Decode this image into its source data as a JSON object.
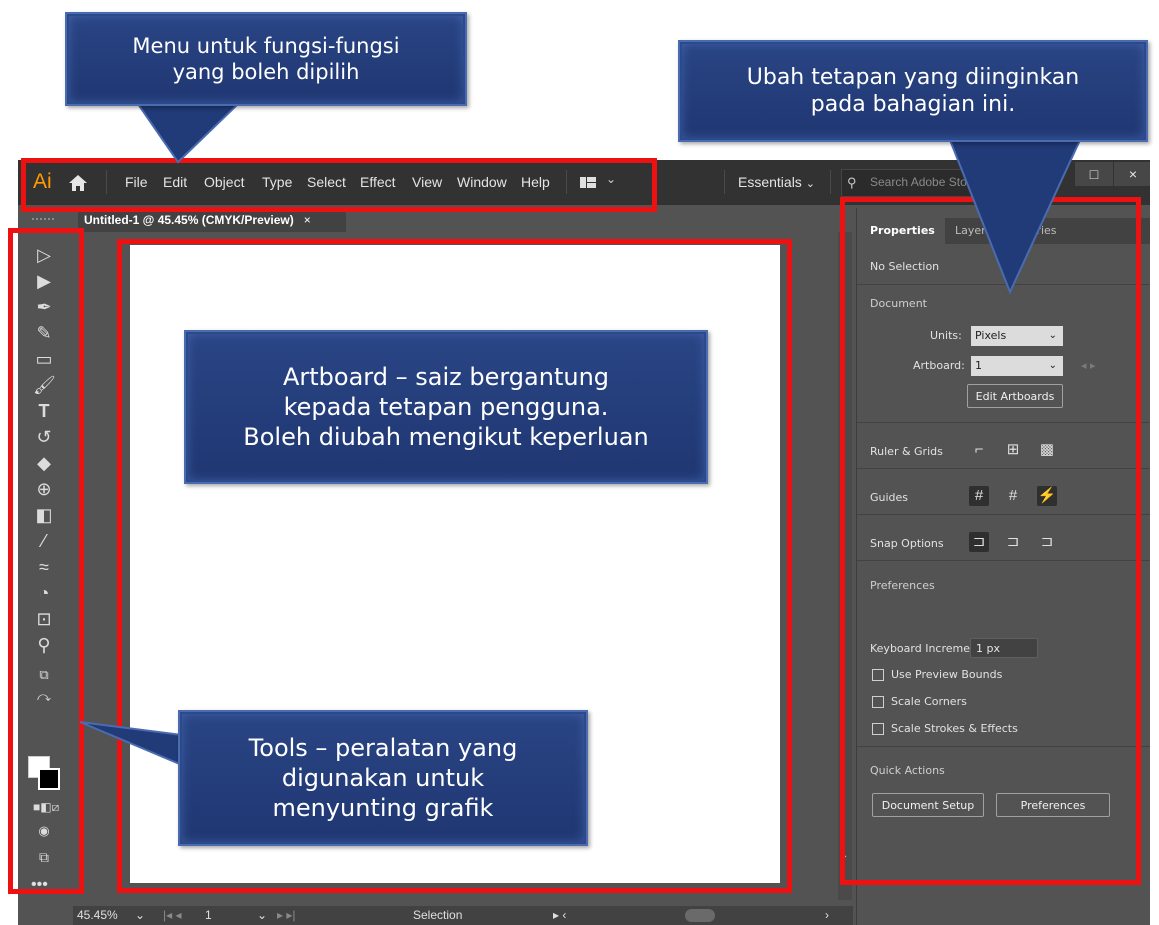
{
  "app": {
    "logo": "Ai",
    "menu": [
      "File",
      "Edit",
      "Object",
      "Type",
      "Select",
      "Effect",
      "View",
      "Window",
      "Help"
    ],
    "workspace": "Essentials",
    "search_placeholder": "Search Adobe Stoc",
    "win_restore": "□",
    "win_close": "×"
  },
  "document": {
    "tab_title": "Untitled-1 @ 45.45% (CMYK/Preview)",
    "tab_close": "×"
  },
  "status": {
    "zoom": "45.45%",
    "artboard_num": "1",
    "tool_name": "Selection"
  },
  "panel": {
    "tabs": [
      "Properties",
      "Layers",
      "Libraries"
    ],
    "selection": "No Selection",
    "document_heading": "Document",
    "units_label": "Units:",
    "units_value": "Pixels",
    "artboard_label": "Artboard:",
    "artboard_value": "1",
    "edit_artboards": "Edit Artboards",
    "ruler_grids": "Ruler & Grids",
    "guides": "Guides",
    "snap_options": "Snap Options",
    "preferences_heading": "Preferences",
    "keyboard_increment_label": "Keyboard Increment:",
    "keyboard_increment_value": "1 px",
    "use_preview_bounds": "Use Preview Bounds",
    "scale_corners": "Scale Corners",
    "scale_strokes": "Scale Strokes & Effects",
    "quick_actions": "Quick Actions",
    "document_setup": "Document Setup",
    "preferences_button": "Preferences"
  },
  "callouts": {
    "menu": "Menu untuk fungsi-fungsi\nyang boleh dipilih",
    "panel": "Ubah tetapan yang diinginkan\npada bahagian ini.",
    "artboard": "Artboard – saiz bergantung\nkepada tetapan pengguna.\nBoleh diubah mengikut keperluan",
    "tools": "Tools – peralatan yang\ndigunakan untuk\nmenyunting grafik"
  },
  "colors": {
    "highlight_red": "#ee1111",
    "callout_blue": "#213a78",
    "ai_orange": "#ff9a00"
  }
}
